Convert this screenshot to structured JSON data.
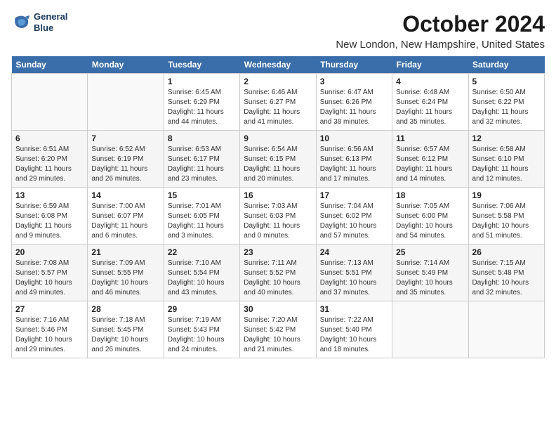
{
  "header": {
    "logo_line1": "General",
    "logo_line2": "Blue",
    "month": "October 2024",
    "location": "New London, New Hampshire, United States"
  },
  "weekdays": [
    "Sunday",
    "Monday",
    "Tuesday",
    "Wednesday",
    "Thursday",
    "Friday",
    "Saturday"
  ],
  "weeks": [
    [
      {
        "day": "",
        "info": ""
      },
      {
        "day": "",
        "info": ""
      },
      {
        "day": "1",
        "info": "Sunrise: 6:45 AM\nSunset: 6:29 PM\nDaylight: 11 hours and 44 minutes."
      },
      {
        "day": "2",
        "info": "Sunrise: 6:46 AM\nSunset: 6:27 PM\nDaylight: 11 hours and 41 minutes."
      },
      {
        "day": "3",
        "info": "Sunrise: 6:47 AM\nSunset: 6:26 PM\nDaylight: 11 hours and 38 minutes."
      },
      {
        "day": "4",
        "info": "Sunrise: 6:48 AM\nSunset: 6:24 PM\nDaylight: 11 hours and 35 minutes."
      },
      {
        "day": "5",
        "info": "Sunrise: 6:50 AM\nSunset: 6:22 PM\nDaylight: 11 hours and 32 minutes."
      }
    ],
    [
      {
        "day": "6",
        "info": "Sunrise: 6:51 AM\nSunset: 6:20 PM\nDaylight: 11 hours and 29 minutes."
      },
      {
        "day": "7",
        "info": "Sunrise: 6:52 AM\nSunset: 6:19 PM\nDaylight: 11 hours and 26 minutes."
      },
      {
        "day": "8",
        "info": "Sunrise: 6:53 AM\nSunset: 6:17 PM\nDaylight: 11 hours and 23 minutes."
      },
      {
        "day": "9",
        "info": "Sunrise: 6:54 AM\nSunset: 6:15 PM\nDaylight: 11 hours and 20 minutes."
      },
      {
        "day": "10",
        "info": "Sunrise: 6:56 AM\nSunset: 6:13 PM\nDaylight: 11 hours and 17 minutes."
      },
      {
        "day": "11",
        "info": "Sunrise: 6:57 AM\nSunset: 6:12 PM\nDaylight: 11 hours and 14 minutes."
      },
      {
        "day": "12",
        "info": "Sunrise: 6:58 AM\nSunset: 6:10 PM\nDaylight: 11 hours and 12 minutes."
      }
    ],
    [
      {
        "day": "13",
        "info": "Sunrise: 6:59 AM\nSunset: 6:08 PM\nDaylight: 11 hours and 9 minutes."
      },
      {
        "day": "14",
        "info": "Sunrise: 7:00 AM\nSunset: 6:07 PM\nDaylight: 11 hours and 6 minutes."
      },
      {
        "day": "15",
        "info": "Sunrise: 7:01 AM\nSunset: 6:05 PM\nDaylight: 11 hours and 3 minutes."
      },
      {
        "day": "16",
        "info": "Sunrise: 7:03 AM\nSunset: 6:03 PM\nDaylight: 11 hours and 0 minutes."
      },
      {
        "day": "17",
        "info": "Sunrise: 7:04 AM\nSunset: 6:02 PM\nDaylight: 10 hours and 57 minutes."
      },
      {
        "day": "18",
        "info": "Sunrise: 7:05 AM\nSunset: 6:00 PM\nDaylight: 10 hours and 54 minutes."
      },
      {
        "day": "19",
        "info": "Sunrise: 7:06 AM\nSunset: 5:58 PM\nDaylight: 10 hours and 51 minutes."
      }
    ],
    [
      {
        "day": "20",
        "info": "Sunrise: 7:08 AM\nSunset: 5:57 PM\nDaylight: 10 hours and 49 minutes."
      },
      {
        "day": "21",
        "info": "Sunrise: 7:09 AM\nSunset: 5:55 PM\nDaylight: 10 hours and 46 minutes."
      },
      {
        "day": "22",
        "info": "Sunrise: 7:10 AM\nSunset: 5:54 PM\nDaylight: 10 hours and 43 minutes."
      },
      {
        "day": "23",
        "info": "Sunrise: 7:11 AM\nSunset: 5:52 PM\nDaylight: 10 hours and 40 minutes."
      },
      {
        "day": "24",
        "info": "Sunrise: 7:13 AM\nSunset: 5:51 PM\nDaylight: 10 hours and 37 minutes."
      },
      {
        "day": "25",
        "info": "Sunrise: 7:14 AM\nSunset: 5:49 PM\nDaylight: 10 hours and 35 minutes."
      },
      {
        "day": "26",
        "info": "Sunrise: 7:15 AM\nSunset: 5:48 PM\nDaylight: 10 hours and 32 minutes."
      }
    ],
    [
      {
        "day": "27",
        "info": "Sunrise: 7:16 AM\nSunset: 5:46 PM\nDaylight: 10 hours and 29 minutes."
      },
      {
        "day": "28",
        "info": "Sunrise: 7:18 AM\nSunset: 5:45 PM\nDaylight: 10 hours and 26 minutes."
      },
      {
        "day": "29",
        "info": "Sunrise: 7:19 AM\nSunset: 5:43 PM\nDaylight: 10 hours and 24 minutes."
      },
      {
        "day": "30",
        "info": "Sunrise: 7:20 AM\nSunset: 5:42 PM\nDaylight: 10 hours and 21 minutes."
      },
      {
        "day": "31",
        "info": "Sunrise: 7:22 AM\nSunset: 5:40 PM\nDaylight: 10 hours and 18 minutes."
      },
      {
        "day": "",
        "info": ""
      },
      {
        "day": "",
        "info": ""
      }
    ]
  ]
}
